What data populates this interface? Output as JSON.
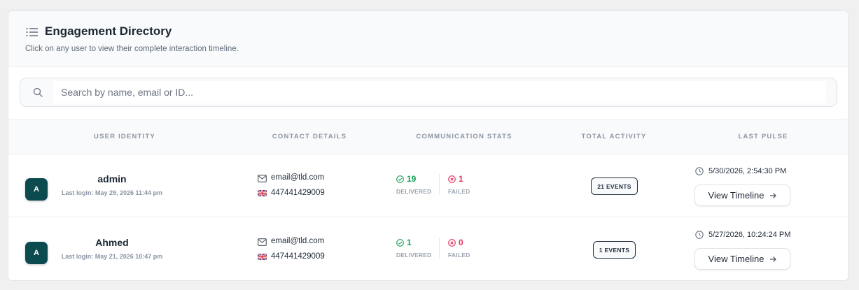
{
  "header": {
    "title": "Engagement Directory",
    "subtitle": "Click on any user to view their complete interaction timeline."
  },
  "search": {
    "placeholder": "Search by name, email or ID...",
    "value": ""
  },
  "columns": [
    "USER IDENTITY",
    "CONTACT DETAILS",
    "COMMUNICATION STATS",
    "TOTAL ACTIVITY",
    "LAST PULSE"
  ],
  "rows": [
    {
      "avatar": "A",
      "name": "admin",
      "last_login": "Last login: May 29, 2026 11:44 pm",
      "email": "email@tld.com",
      "phone": "447441429009",
      "delivered": "19",
      "delivered_label": "DELIVERED",
      "failed": "1",
      "failed_label": "FAILED",
      "events": "21 EVENTS",
      "last_pulse": "5/30/2026, 2:54:30 PM",
      "button": "View Timeline"
    },
    {
      "avatar": "A",
      "name": "Ahmed",
      "last_login": "Last login: May 21, 2026 10:47 pm",
      "email": "email@tld.com",
      "phone": "447441429009",
      "delivered": "1",
      "delivered_label": "DELIVERED",
      "failed": "0",
      "failed_label": "FAILED",
      "events": "1 EVENTS",
      "last_pulse": "5/27/2026, 10:24:24 PM",
      "button": "View Timeline"
    }
  ],
  "colors": {
    "avatar_bg": "#0b4a4f",
    "delivered": "#1a9e5a",
    "failed": "#e0345c"
  },
  "icons": {
    "header": "list-icon",
    "search": "search-icon",
    "email": "mail-icon",
    "phone": "uk-flag-icon",
    "delivered": "check-circle-icon",
    "failed": "x-circle-icon",
    "pulse": "clock-icon",
    "button": "arrow-right-icon"
  }
}
